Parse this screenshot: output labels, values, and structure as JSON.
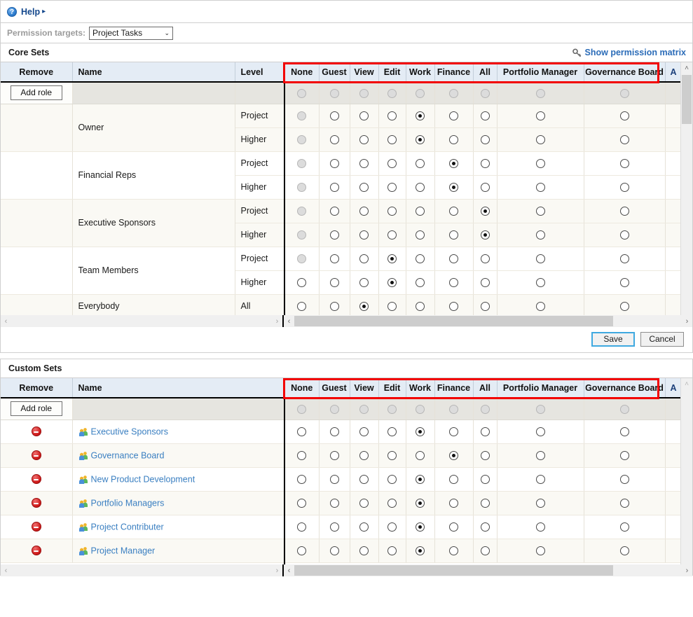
{
  "help": {
    "label": "Help",
    "arrow": "▸",
    "icon_char": "?"
  },
  "permission_targets": {
    "label": "Permission targets:",
    "value": "Project Tasks",
    "caret": "⌄"
  },
  "permission_columns": [
    "None",
    "Guest",
    "View",
    "Edit",
    "Work",
    "Finance",
    "All",
    "Portfolio Manager",
    "Governance Board"
  ],
  "partial_column": "A",
  "core_sets": {
    "title": "Core Sets",
    "matrix_link": "Show permission matrix",
    "columns": {
      "remove": "Remove",
      "name": "Name",
      "level": "Level"
    },
    "add_role": "Add role",
    "rows": [
      {
        "name": "Owner",
        "level": "Project",
        "selected": "Work",
        "none_disabled": true,
        "shade": "cream"
      },
      {
        "name": "Owner",
        "level": "Higher",
        "selected": "Work",
        "none_disabled": true,
        "shade": "cream"
      },
      {
        "name": "Financial Reps",
        "level": "Project",
        "selected": "Finance",
        "none_disabled": true,
        "shade": "white"
      },
      {
        "name": "Financial Reps",
        "level": "Higher",
        "selected": "Finance",
        "none_disabled": true,
        "shade": "white"
      },
      {
        "name": "Executive Sponsors",
        "level": "Project",
        "selected": "All",
        "none_disabled": true,
        "shade": "cream"
      },
      {
        "name": "Executive Sponsors",
        "level": "Higher",
        "selected": "All",
        "none_disabled": true,
        "shade": "cream"
      },
      {
        "name": "Team Members",
        "level": "Project",
        "selected": "Edit",
        "none_disabled": true,
        "shade": "white"
      },
      {
        "name": "Team Members",
        "level": "Higher",
        "selected": "Edit",
        "none_disabled": false,
        "shade": "white"
      },
      {
        "name": "Everybody",
        "level": "All",
        "selected": "View",
        "none_disabled": false,
        "shade": "cream"
      }
    ],
    "name_groups": [
      {
        "name": "Owner",
        "span": 2,
        "shade": "cream"
      },
      {
        "name": "Financial Reps",
        "span": 2,
        "shade": "white"
      },
      {
        "name": "Executive Sponsors",
        "span": 2,
        "shade": "cream"
      },
      {
        "name": "Team Members",
        "span": 2,
        "shade": "white"
      },
      {
        "name": "Everybody",
        "span": 1,
        "shade": "cream"
      }
    ],
    "buttons": {
      "save": "Save",
      "cancel": "Cancel"
    }
  },
  "custom_sets": {
    "title": "Custom Sets",
    "columns": {
      "remove": "Remove",
      "name": "Name"
    },
    "add_role": "Add role",
    "rows": [
      {
        "name": "Executive Sponsors",
        "selected": "Work",
        "shade": "white"
      },
      {
        "name": "Governance Board",
        "selected": "Finance",
        "shade": "cream"
      },
      {
        "name": "New Product Development",
        "selected": "Work",
        "shade": "white"
      },
      {
        "name": "Portfolio Managers",
        "selected": "Work",
        "shade": "cream"
      },
      {
        "name": "Project Contributer",
        "selected": "Work",
        "shade": "white"
      },
      {
        "name": "Project Manager",
        "selected": "Work",
        "shade": "cream"
      }
    ]
  },
  "scroll": {
    "left_arrow": "‹",
    "right_arrow": "›",
    "up_arrow": "˄",
    "down_arrow": "˅"
  },
  "colors": {
    "accent": "#2b6cb8",
    "highlight": "#f20000",
    "header_bg": "#e4ecf5",
    "remove": "#d01c1c"
  }
}
